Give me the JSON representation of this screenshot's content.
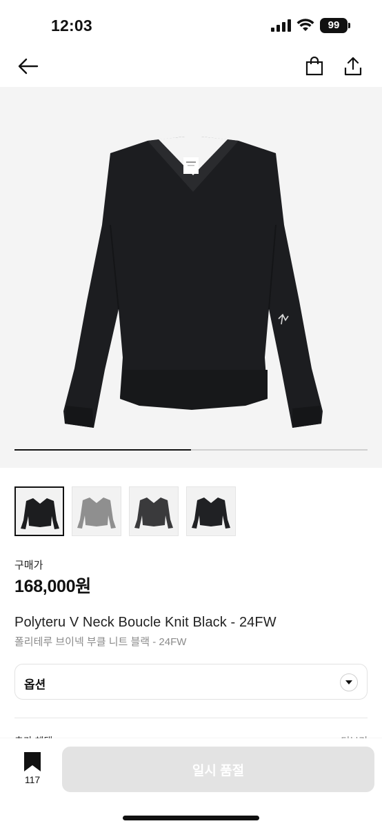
{
  "status_bar": {
    "time": "12:03",
    "battery": "99"
  },
  "nav": {
    "back_icon": "arrow-left-icon",
    "cart_icon": "shopping-bag-icon",
    "share_icon": "share-icon"
  },
  "gallery": {
    "image_count": 4,
    "current_index": 1,
    "progress_fraction": 0.5,
    "thumbnails": [
      {
        "name": "black-vneck-front",
        "color": "#1c1d1f",
        "active": true
      },
      {
        "name": "grey-boucle-knit",
        "color": "#8f8f8f",
        "active": false
      },
      {
        "name": "charcoal-vneck",
        "color": "#3a3a3c",
        "active": false
      },
      {
        "name": "black-vneck-alt",
        "color": "#202124",
        "active": false
      }
    ]
  },
  "product": {
    "price_label": "구매가",
    "price": "168,000원",
    "title_en": "Polyteru V Neck Boucle Knit Black - 24FW",
    "title_ko": "폴리테루 브이넥 부클 니트 블랙 - 24FW"
  },
  "option": {
    "label": "옵션"
  },
  "peek": {
    "left": "추가 혜택",
    "right": "더보기"
  },
  "bottom": {
    "wish_count": "117",
    "cta_label": "일시 품절"
  },
  "colors": {
    "accent": "#111111",
    "cta_disabled_bg": "#e3e3e3",
    "hero_bg": "#f4f4f4"
  }
}
